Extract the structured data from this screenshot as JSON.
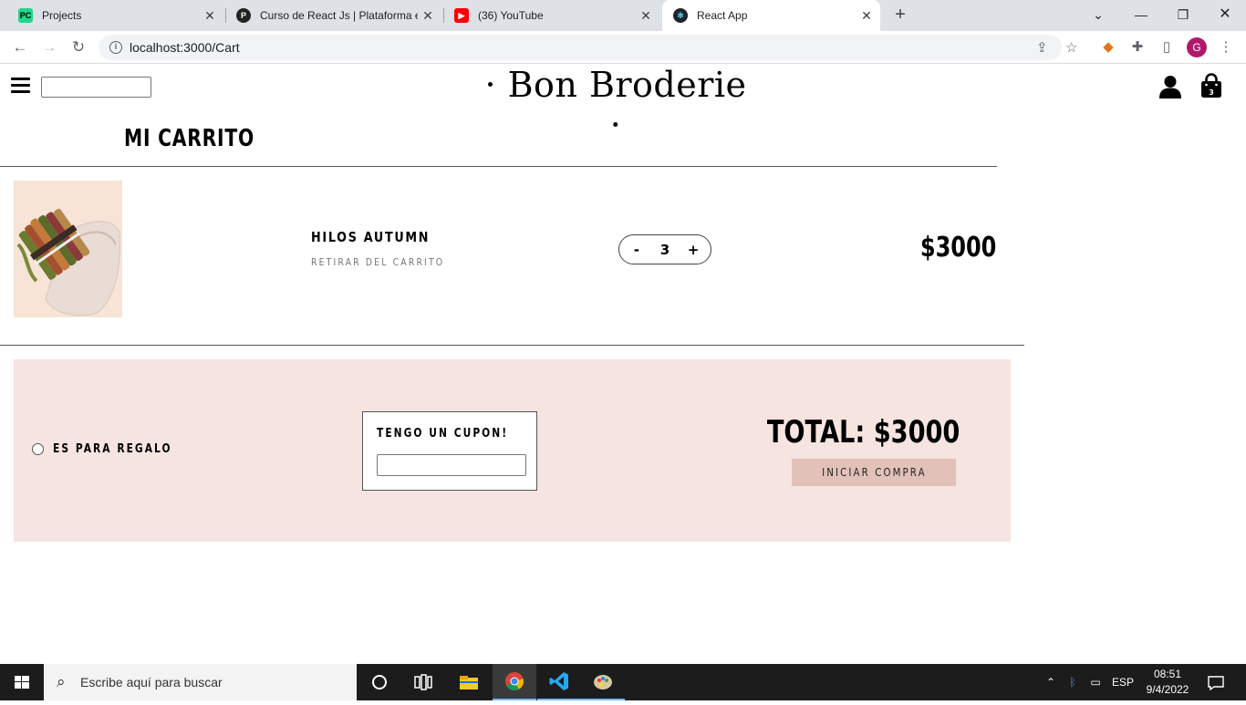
{
  "browser": {
    "tabs": [
      {
        "title": "Projects",
        "active": false
      },
      {
        "title": "Curso de React Js | Plataforma el...",
        "active": false
      },
      {
        "title": "(36) YouTube",
        "active": false
      },
      {
        "title": "React App",
        "active": true
      }
    ],
    "url": "localhost:3000/Cart",
    "profile_initial": "G"
  },
  "site": {
    "brand": "· Bon Broderie ·",
    "cart_count": "3"
  },
  "cart": {
    "title": "MI CARRITO",
    "item": {
      "name": "HILOS AUTUMN",
      "remove_label": "RETIRAR DEL CARRITO",
      "quantity": "3",
      "decrement_label": "-",
      "increment_label": "+",
      "price": "$3000"
    },
    "summary": {
      "gift_label": "ES PARA REGALO",
      "coupon_label": "TENGO UN CUPON!",
      "total": "TOTAL: $3000",
      "buy_label": "INICIAR COMPRA"
    }
  },
  "taskbar": {
    "search_placeholder": "Escribe aquí para buscar",
    "language": "ESP",
    "time": "08:51",
    "date": "9/4/2022"
  }
}
